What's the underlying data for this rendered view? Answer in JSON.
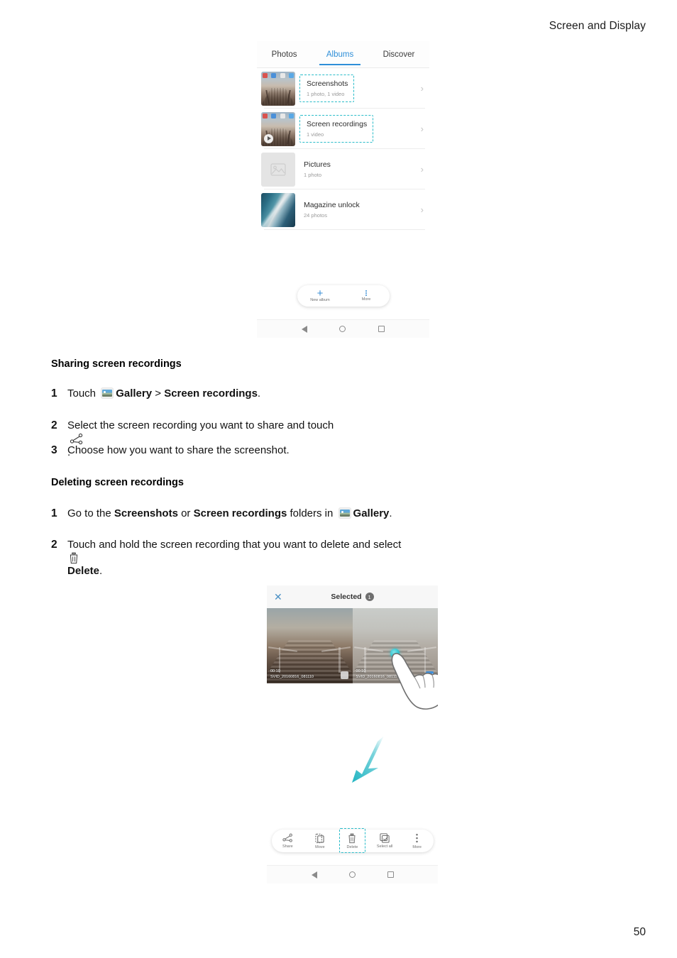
{
  "page": {
    "header_title": "Screen and Display",
    "page_number": "50"
  },
  "figure_albums": {
    "tabs": [
      {
        "label": "Photos",
        "active": false
      },
      {
        "label": "Albums",
        "active": true
      },
      {
        "label": "Discover",
        "active": false
      }
    ],
    "albums": [
      {
        "name": "Screenshots",
        "count": "1 photo, 1 video",
        "highlighted": true,
        "thumb": "pier-screenshot-thumbnail"
      },
      {
        "name": "Screen recordings",
        "count": "1 video",
        "highlighted": true,
        "thumb": "pier-video-thumbnail"
      },
      {
        "name": "Pictures",
        "count": "1 photo",
        "highlighted": false,
        "thumb": "placeholder-image-thumbnail"
      },
      {
        "name": "Magazine unlock",
        "count": "24 photos",
        "highlighted": false,
        "thumb": "ocean-wave-thumbnail"
      }
    ],
    "toolbar": [
      {
        "label": "New album",
        "icon": "plus-icon"
      },
      {
        "label": "More",
        "icon": "more-vertical-icon"
      }
    ],
    "navbar": [
      "back-icon",
      "home-icon",
      "recents-icon"
    ]
  },
  "section_sharing": {
    "title": "Sharing screen recordings",
    "steps": [
      {
        "num": "1",
        "parts": [
          {
            "t": "text",
            "v": "Touch "
          },
          {
            "t": "icon",
            "v": "gallery-icon"
          },
          {
            "t": "bold",
            "v": "Gallery"
          },
          {
            "t": "text",
            "v": " > "
          },
          {
            "t": "bold",
            "v": "Screen recordings"
          },
          {
            "t": "text",
            "v": "."
          }
        ]
      },
      {
        "num": "2",
        "parts": [
          {
            "t": "text",
            "v": "Select the screen recording you want to share and touch "
          },
          {
            "t": "icon",
            "v": "share-icon"
          },
          {
            "t": "text",
            "v": "."
          }
        ]
      },
      {
        "num": "3",
        "parts": [
          {
            "t": "text",
            "v": "Choose how you want to share the screenshot."
          }
        ]
      }
    ]
  },
  "section_deleting": {
    "title": "Deleting screen recordings",
    "steps": [
      {
        "num": "1",
        "parts": [
          {
            "t": "text",
            "v": "Go to the "
          },
          {
            "t": "bold",
            "v": "Screenshots"
          },
          {
            "t": "text",
            "v": " or "
          },
          {
            "t": "bold",
            "v": "Screen recordings"
          },
          {
            "t": "text",
            "v": " folders in "
          },
          {
            "t": "icon",
            "v": "gallery-icon"
          },
          {
            "t": "bold",
            "v": "Gallery"
          },
          {
            "t": "text",
            "v": "."
          }
        ]
      },
      {
        "num": "2",
        "parts": [
          {
            "t": "text",
            "v": "Touch and hold the screen recording that you want to delete and select "
          },
          {
            "t": "icon",
            "v": "trash-icon"
          },
          {
            "t": "bold",
            "v": "Delete"
          },
          {
            "t": "text",
            "v": "."
          }
        ]
      }
    ]
  },
  "figure_selected": {
    "header": {
      "close_icon": "close-icon",
      "title": "Selected",
      "badge": "1"
    },
    "videos": [
      {
        "duration": "00:10",
        "filename": "SVID_20160816_081110",
        "selected": false
      },
      {
        "duration": "00:10",
        "filename": "SVID_20160816_081110",
        "selected": true
      }
    ],
    "toolbar": [
      {
        "label": "Share",
        "icon": "share-icon",
        "highlighted": false
      },
      {
        "label": "Move",
        "icon": "move-icon",
        "highlighted": false
      },
      {
        "label": "Delete",
        "icon": "trash-icon",
        "highlighted": true
      },
      {
        "label": "Select all",
        "icon": "select-all-icon",
        "highlighted": false
      },
      {
        "label": "More",
        "icon": "more-vertical-icon",
        "highlighted": false
      }
    ],
    "navbar": [
      "back-icon",
      "home-icon",
      "recents-icon"
    ],
    "annotations": {
      "touch_gesture": "pointing-hand-cursor",
      "arrow": "down-left-arrow"
    }
  },
  "colors": {
    "accent_blue": "#2f8fd8",
    "highlight_teal": "#29bcc9",
    "selected_blue": "#3f8fd9",
    "text": "#121212",
    "muted": "#9a9a9a"
  }
}
